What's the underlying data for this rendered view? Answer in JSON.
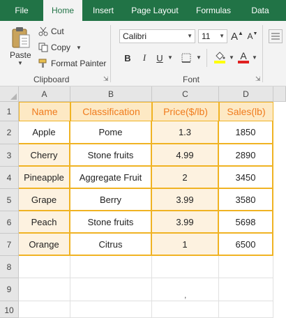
{
  "ribbon_tabs": [
    "File",
    "Home",
    "Insert",
    "Page Layout",
    "Formulas",
    "Data"
  ],
  "clipboard": {
    "paste_label": "Paste",
    "cut_label": "Cut",
    "copy_label": "Copy",
    "format_painter_label": "Format Painter",
    "group_label": "Clipboard"
  },
  "font": {
    "font_name": "Calibri",
    "font_size": "11",
    "group_label": "Font",
    "bold": "B",
    "italic": "I",
    "underline": "U",
    "grow": "A",
    "shrink": "A",
    "font_color_glyph": "A"
  },
  "colors": {
    "ribbon_green": "#217346",
    "header_fill": "#fde9c4",
    "header_text": "#f07b1d",
    "border_orange": "#f0b323",
    "fill_yellow": "#ffff00",
    "font_red": "#e02020"
  },
  "sheet": {
    "columns": [
      "A",
      "B",
      "C",
      "D"
    ],
    "rows": [
      "1",
      "2",
      "3",
      "4",
      "5",
      "6",
      "7",
      "8",
      "9",
      "10"
    ],
    "header": [
      "Name",
      "Classification",
      "Price($/lb)",
      "Sales(lb)"
    ],
    "data": [
      [
        "Apple",
        "Pome",
        "1.3",
        "1850"
      ],
      [
        "Cherry",
        "Stone fruits",
        "4.99",
        "2890"
      ],
      [
        "Pineapple",
        "Aggregate Fruit",
        "2",
        "3450"
      ],
      [
        "Grape",
        "Berry",
        "3.99",
        "3580"
      ],
      [
        "Peach",
        "Stone fruits",
        "3.99",
        "5698"
      ],
      [
        "Orange",
        "Citrus",
        "1",
        "6500"
      ]
    ],
    "stray_mark": ","
  }
}
